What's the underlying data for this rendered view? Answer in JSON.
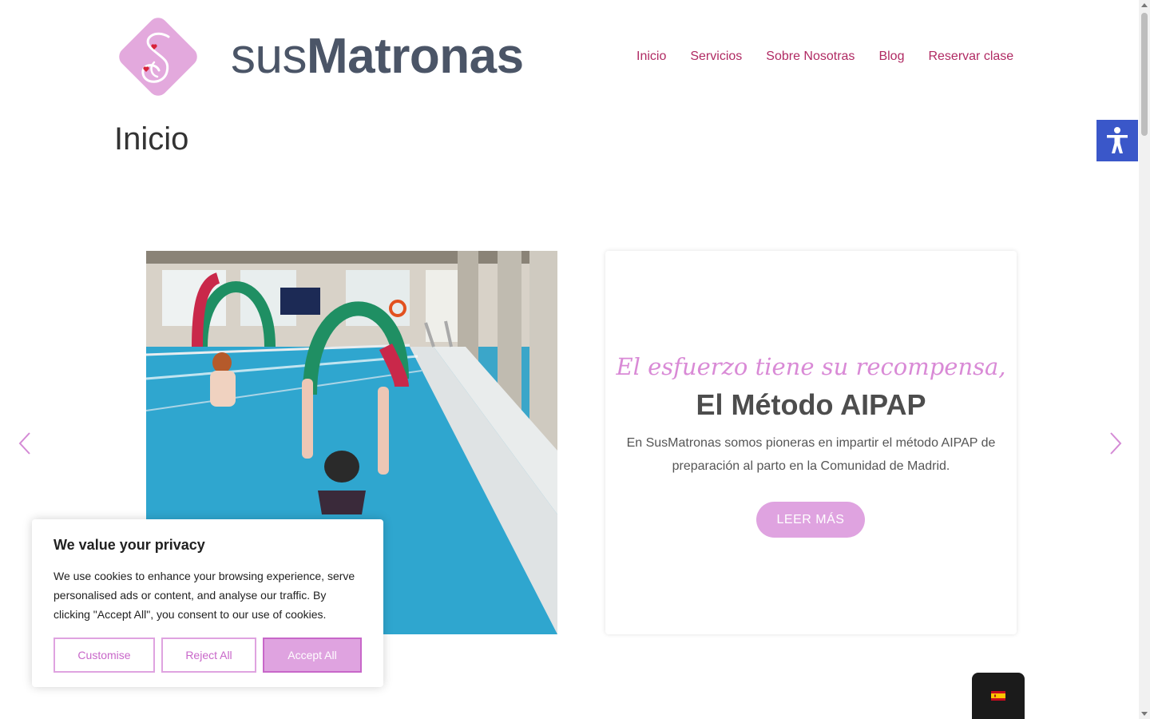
{
  "header": {
    "logo_light": "sus",
    "logo_bold": "Matronas",
    "logo_icon": "logo-mark-icon"
  },
  "nav": {
    "items": [
      {
        "label": "Inicio"
      },
      {
        "label": "Servicios"
      },
      {
        "label": "Sobre Nosotras"
      },
      {
        "label": "Blog"
      },
      {
        "label": "Reservar clase"
      }
    ]
  },
  "page": {
    "title": "Inicio"
  },
  "slide": {
    "tagline": "El esfuerzo tiene su recompensa,",
    "heading": "El Método AIPAP",
    "description": "En SusMatronas somos pioneras en impartir el método AIPAP de preparación al parto en la Comunidad de Madrid.",
    "button_label": "LEER MÁS"
  },
  "cookie": {
    "title": "We value your privacy",
    "text": "We use cookies to enhance your browsing experience, serve personalised ads or content, and analyse our traffic. By clicking \"Accept All\", you consent to our use of cookies.",
    "customise_label": "Customise",
    "reject_label": "Reject All",
    "accept_label": "Accept All"
  },
  "colors": {
    "brand_pink": "#b02a63",
    "accent_lilac": "#dfa3e0",
    "logo_gray": "#4b5567",
    "accessibility_blue": "#3a57c9"
  },
  "icons": {
    "accessibility": "accessibility-icon",
    "prev": "chevron-left-icon",
    "next": "chevron-right-icon",
    "language": "spain-flag-icon"
  }
}
